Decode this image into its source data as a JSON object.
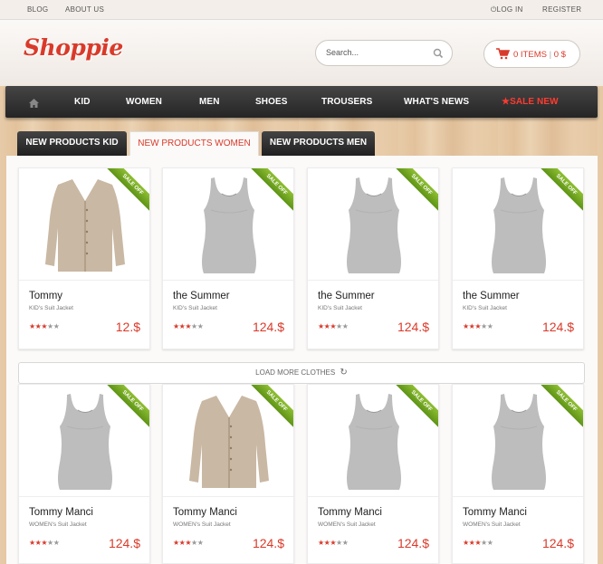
{
  "topbar": {
    "blog": "BLOG",
    "about": "ABOUT US",
    "login": "LOG IN",
    "register": "REGISTER"
  },
  "header": {
    "logo": "Shoppie",
    "search_placeholder": "Search...",
    "cart_items": "0 ITEMS",
    "cart_total": "0 $"
  },
  "nav": {
    "kid": "KID",
    "women": "WOMEN",
    "men": "MEN",
    "shoes": "SHOES",
    "trousers": "TROUSERS",
    "whats_news": "WHAT'S NEWS",
    "sale": "SALE NEW"
  },
  "tabs": {
    "kid": "NEW PRODUCTS KID",
    "women": "NEW PRODUCTS WOMEN",
    "men": "NEW PRODUCTS MEN"
  },
  "ribbon": "SALE OFF",
  "load_more": "LOAD MORE CLOTHES",
  "colors": {
    "accent": "#d93a2a",
    "nav_bg": "#2d2d2d",
    "ribbon": "#6fa21f"
  },
  "products": [
    {
      "name": "Tommy",
      "sub": "KID's Suit Jacket",
      "price": "12.$",
      "rating": 3,
      "image": "cardigan"
    },
    {
      "name": "the Summer",
      "sub": "KID's Suit Jacket",
      "price": "124.$",
      "rating": 3,
      "image": "tank"
    },
    {
      "name": "the Summer",
      "sub": "KID's Suit Jacket",
      "price": "124.$",
      "rating": 3,
      "image": "tank"
    },
    {
      "name": "the Summer",
      "sub": "KID's Suit Jacket",
      "price": "124.$",
      "rating": 3,
      "image": "tank"
    },
    {
      "name": "Tommy Manci",
      "sub": "WOMEN's Suit Jacket",
      "price": "124.$",
      "rating": 3,
      "image": "tank"
    },
    {
      "name": "Tommy Manci",
      "sub": "WOMEN's Suit Jacket",
      "price": "124.$",
      "rating": 3,
      "image": "cardigan"
    },
    {
      "name": "Tommy Manci",
      "sub": "WOMEN's Suit Jacket",
      "price": "124.$",
      "rating": 3,
      "image": "tank"
    },
    {
      "name": "Tommy Manci",
      "sub": "WOMEN's Suit Jacket",
      "price": "124.$",
      "rating": 3,
      "image": "tank"
    }
  ]
}
